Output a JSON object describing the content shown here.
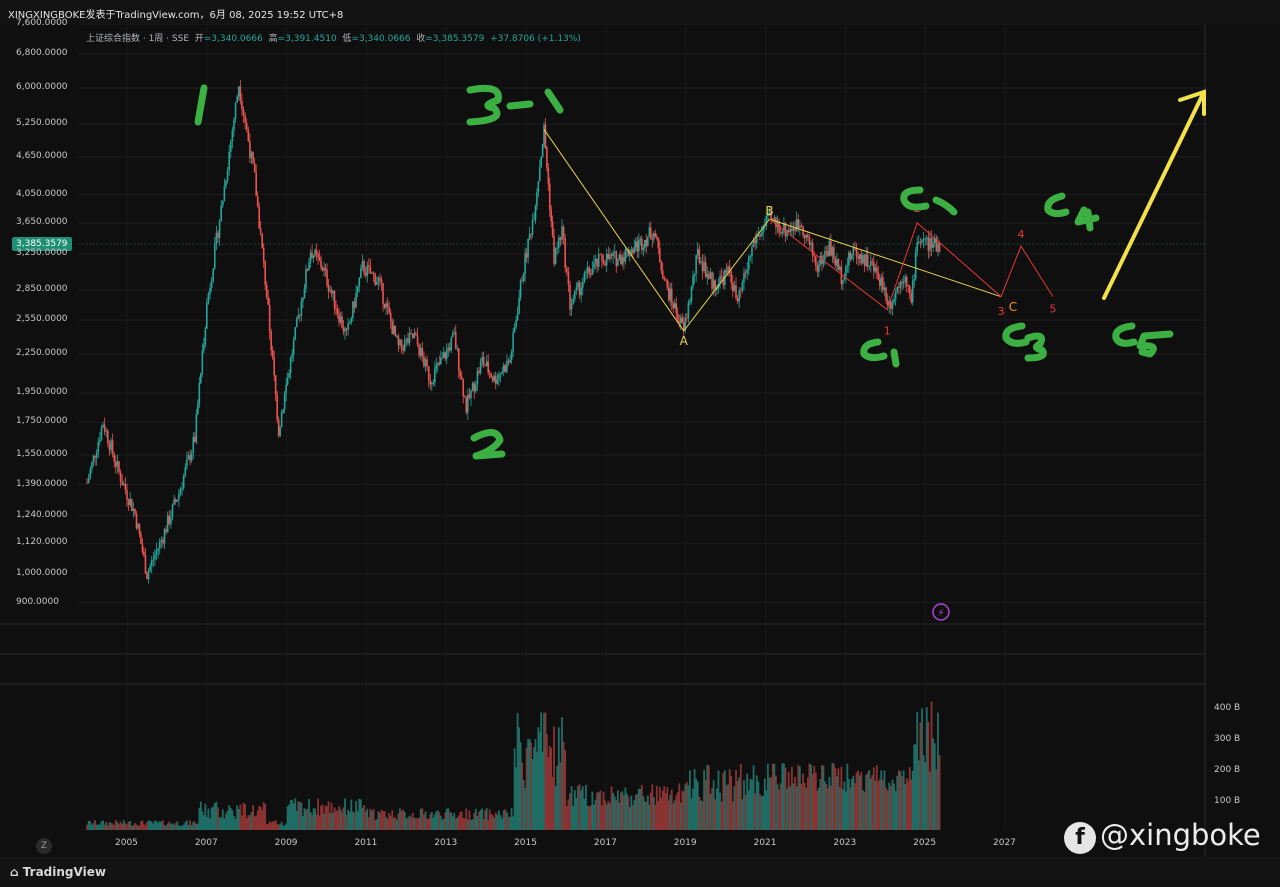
{
  "header": {
    "title": "XINGXINGBOKE发表于TradingView.com，6月 08, 2025 19:52 UTC+8"
  },
  "legend": {
    "symbol": "上证综合指数 · 1周 · SSE",
    "open_label": "开",
    "open": "=3,340.0666",
    "high_label": "高",
    "high": "=3,391.4510",
    "low_label": "低",
    "low": "=3,340.0666",
    "close_label": "收",
    "close": "=3,385.3579",
    "change": "+37.8706 (+1.13%)"
  },
  "price_tag": "3,385.3579",
  "colors": {
    "up": "#26a69a",
    "down": "#ef5350",
    "yellow": "#e8d44d",
    "green_ink": "#3cb043",
    "red_wave": "#e53935"
  },
  "footer": {
    "brand": "TradingView",
    "z_button": "Z"
  },
  "watermark": "@xingboke",
  "chart_data": {
    "type": "line",
    "title": "",
    "x_ticks": [
      "2005",
      "2007",
      "2009",
      "2011",
      "2013",
      "2015",
      "2017",
      "2019",
      "2021",
      "2023",
      "2025",
      "2027"
    ],
    "y_ticks": [
      "7,600.0000",
      "6,800.0000",
      "6,000.0000",
      "5,250.0000",
      "4,650.0000",
      "4,050.0000",
      "3,650.0000",
      "3,250.0000",
      "2,850.0000",
      "2,550.0000",
      "2,250.0000",
      "1,950.0000",
      "1,750.0000",
      "1,550.0000",
      "1,390.0000",
      "1,240.0000",
      "1,120.0000",
      "1,000.0000",
      "900.0000"
    ],
    "y_scale": "log",
    "volume_ticks": [
      "400 B",
      "300 B",
      "200 B",
      "100 B"
    ],
    "series": [
      {
        "values": [
          [
            2004.0,
            1400
          ],
          [
            2004.4,
            1750
          ],
          [
            2004.8,
            1450
          ],
          [
            2005.2,
            1250
          ],
          [
            2005.5,
            1000
          ],
          [
            2005.9,
            1150
          ],
          [
            2006.3,
            1350
          ],
          [
            2006.7,
            1650
          ],
          [
            2007.0,
            2700
          ],
          [
            2007.4,
            4000
          ],
          [
            2007.8,
            6100
          ],
          [
            2008.2,
            4300
          ],
          [
            2008.5,
            2800
          ],
          [
            2008.8,
            1700
          ],
          [
            2009.1,
            2200
          ],
          [
            2009.6,
            3300
          ],
          [
            2009.9,
            3100
          ],
          [
            2010.5,
            2400
          ],
          [
            2010.9,
            3100
          ],
          [
            2011.3,
            2950
          ],
          [
            2011.8,
            2300
          ],
          [
            2012.2,
            2400
          ],
          [
            2012.6,
            2050
          ],
          [
            2012.9,
            2200
          ],
          [
            2013.2,
            2400
          ],
          [
            2013.5,
            1850
          ],
          [
            2013.9,
            2200
          ],
          [
            2014.2,
            2050
          ],
          [
            2014.6,
            2200
          ],
          [
            2014.9,
            3000
          ],
          [
            2015.2,
            3800
          ],
          [
            2015.45,
            5150
          ],
          [
            2015.7,
            3200
          ],
          [
            2015.9,
            3550
          ],
          [
            2016.1,
            2700
          ],
          [
            2016.5,
            3000
          ],
          [
            2016.9,
            3200
          ],
          [
            2017.3,
            3200
          ],
          [
            2017.9,
            3400
          ],
          [
            2018.2,
            3550
          ],
          [
            2018.5,
            2900
          ],
          [
            2018.95,
            2450
          ],
          [
            2019.3,
            3250
          ],
          [
            2019.7,
            2900
          ],
          [
            2020.1,
            3050
          ],
          [
            2020.3,
            2700
          ],
          [
            2020.7,
            3400
          ],
          [
            2021.1,
            3700
          ],
          [
            2021.5,
            3550
          ],
          [
            2021.9,
            3650
          ],
          [
            2022.3,
            3100
          ],
          [
            2022.6,
            3350
          ],
          [
            2022.9,
            3000
          ],
          [
            2023.2,
            3300
          ],
          [
            2023.6,
            3150
          ],
          [
            2023.9,
            2950
          ],
          [
            2024.1,
            2700
          ],
          [
            2024.5,
            3050
          ],
          [
            2024.65,
            2700
          ],
          [
            2024.8,
            3450
          ],
          [
            2025.2,
            3350
          ],
          [
            2025.4,
            3385
          ]
        ]
      }
    ],
    "annotations": {
      "yellow_path": [
        [
          2015.45,
          5150
        ],
        [
          2018.95,
          2450
        ],
        [
          2021.1,
          3700
        ],
        [
          2026.9,
          2780
        ]
      ],
      "yellow_labels": [
        {
          "text": "A",
          "x": 2018.95,
          "y": 2450
        },
        {
          "text": "B",
          "x": 2021.1,
          "y": 3700
        },
        {
          "text": "C",
          "x": 2027.2,
          "y": 2600
        }
      ],
      "red_wave": [
        [
          2021.1,
          3700
        ],
        [
          2024.05,
          2650
        ],
        [
          2024.8,
          3650
        ],
        [
          2026.9,
          2780
        ],
        [
          2027.4,
          3350
        ],
        [
          2028.2,
          2780
        ]
      ],
      "red_labels": [
        {
          "text": "1",
          "x": 2024.05,
          "y": 2420
        },
        {
          "text": "2",
          "x": 2024.8,
          "y": 3800
        },
        {
          "text": "3",
          "x": 2026.9,
          "y": 2600
        },
        {
          "text": "4",
          "x": 2027.4,
          "y": 3450
        },
        {
          "text": "5",
          "x": 2028.2,
          "y": 2620
        }
      ],
      "handwritten": [
        "1",
        "2",
        "3-1",
        "C1",
        "C2",
        "C3",
        "C4",
        "C5"
      ]
    }
  }
}
